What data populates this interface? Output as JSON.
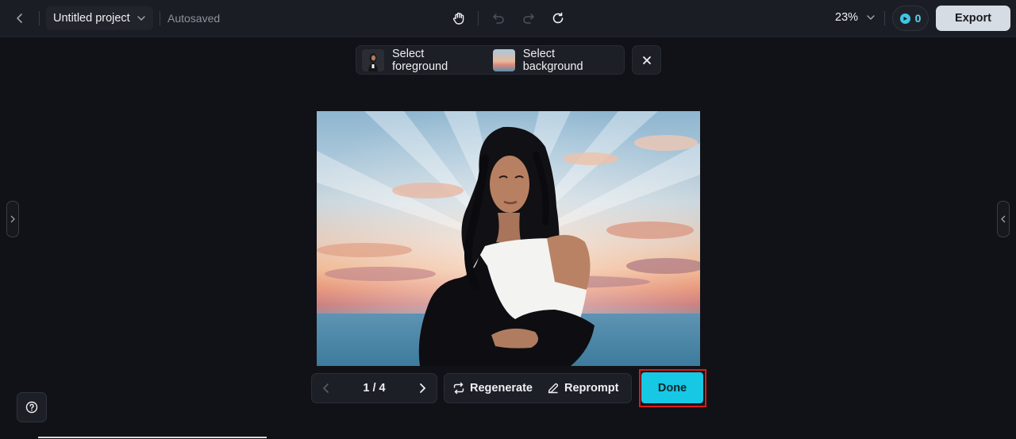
{
  "header": {
    "project_name": "Untitled project",
    "autosaved": "Autosaved",
    "zoom": "23%",
    "credits": "0",
    "export_label": "Export"
  },
  "selection_bar": {
    "foreground_label": "Select foreground",
    "background_label": "Select background"
  },
  "pager": {
    "text": "1 / 4"
  },
  "actions": {
    "regenerate_label": "Regenerate",
    "reprompt_label": "Reprompt",
    "done_label": "Done"
  },
  "colors": {
    "accent": "#16c8e4",
    "highlight": "#e01919",
    "background": "#111217"
  }
}
